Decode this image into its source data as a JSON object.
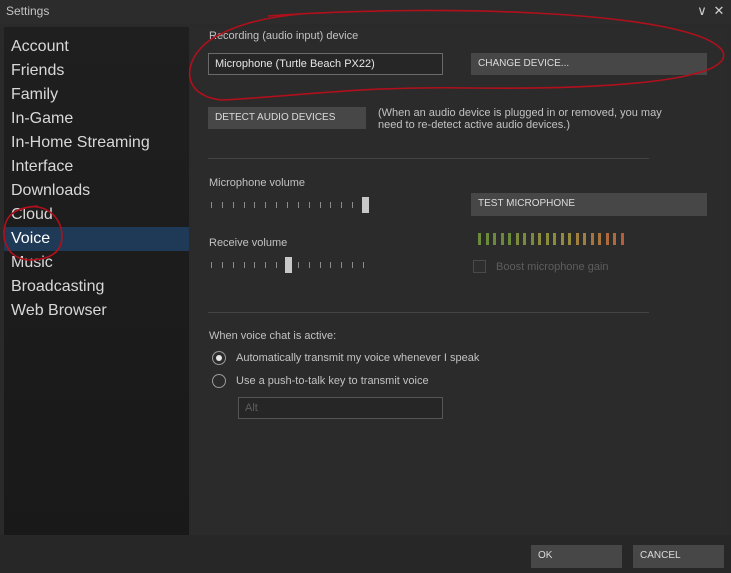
{
  "window": {
    "title": "Settings",
    "minimize_glyph": "∨",
    "close_glyph": "✕"
  },
  "sidebar": {
    "items": [
      {
        "label": "Account",
        "active": false
      },
      {
        "label": "Friends",
        "active": false
      },
      {
        "label": "Family",
        "active": false
      },
      {
        "label": "In-Game",
        "active": false
      },
      {
        "label": "In-Home Streaming",
        "active": false
      },
      {
        "label": "Interface",
        "active": false
      },
      {
        "label": "Downloads",
        "active": false
      },
      {
        "label": "Cloud",
        "active": false
      },
      {
        "label": "Voice",
        "active": true
      },
      {
        "label": "Music",
        "active": false
      },
      {
        "label": "Broadcasting",
        "active": false
      },
      {
        "label": "Web Browser",
        "active": false
      }
    ]
  },
  "voice": {
    "recording_label": "Recording (audio input) device",
    "device_value": "Microphone (Turtle Beach PX22)",
    "change_device_label": "CHANGE DEVICE...",
    "detect_label": "DETECT AUDIO DEVICES",
    "detect_note_line1": "(When an audio device is plugged in or removed, you may",
    "detect_note_line2": "need to re-detect active audio devices.)",
    "mic_volume_label": "Microphone volume",
    "mic_volume_level": 1.0,
    "test_mic_label": "TEST MICROPHONE",
    "receive_volume_label": "Receive volume",
    "receive_volume_level": 0.5,
    "meter_colors": [
      "#6c8a3c",
      "#6c8a3c",
      "#6c8a3c",
      "#6c8a3c",
      "#6c8a3c",
      "#7b8b3c",
      "#7b8b3c",
      "#7b8b3c",
      "#8b8b3c",
      "#8b8b3c",
      "#8b8b3c",
      "#968a3c",
      "#968a3c",
      "#a0803c",
      "#a0803c",
      "#a6763c",
      "#a6763c",
      "#ad6a3c",
      "#ad6a3c",
      "#b55e3c"
    ],
    "boost_label": "Boost microphone gain",
    "boost_checked": false,
    "voice_active_label": "When voice chat is active:",
    "radio_auto_label": "Automatically transmit my voice whenever I speak",
    "radio_ptt_label": "Use a push-to-talk key to transmit voice",
    "ptt_key_value": "Alt"
  },
  "footer": {
    "ok_label": "OK",
    "cancel_label": "CANCEL"
  },
  "colors": {
    "accent_selected": "#1f3a57",
    "annotation_red": "#b0101c"
  }
}
